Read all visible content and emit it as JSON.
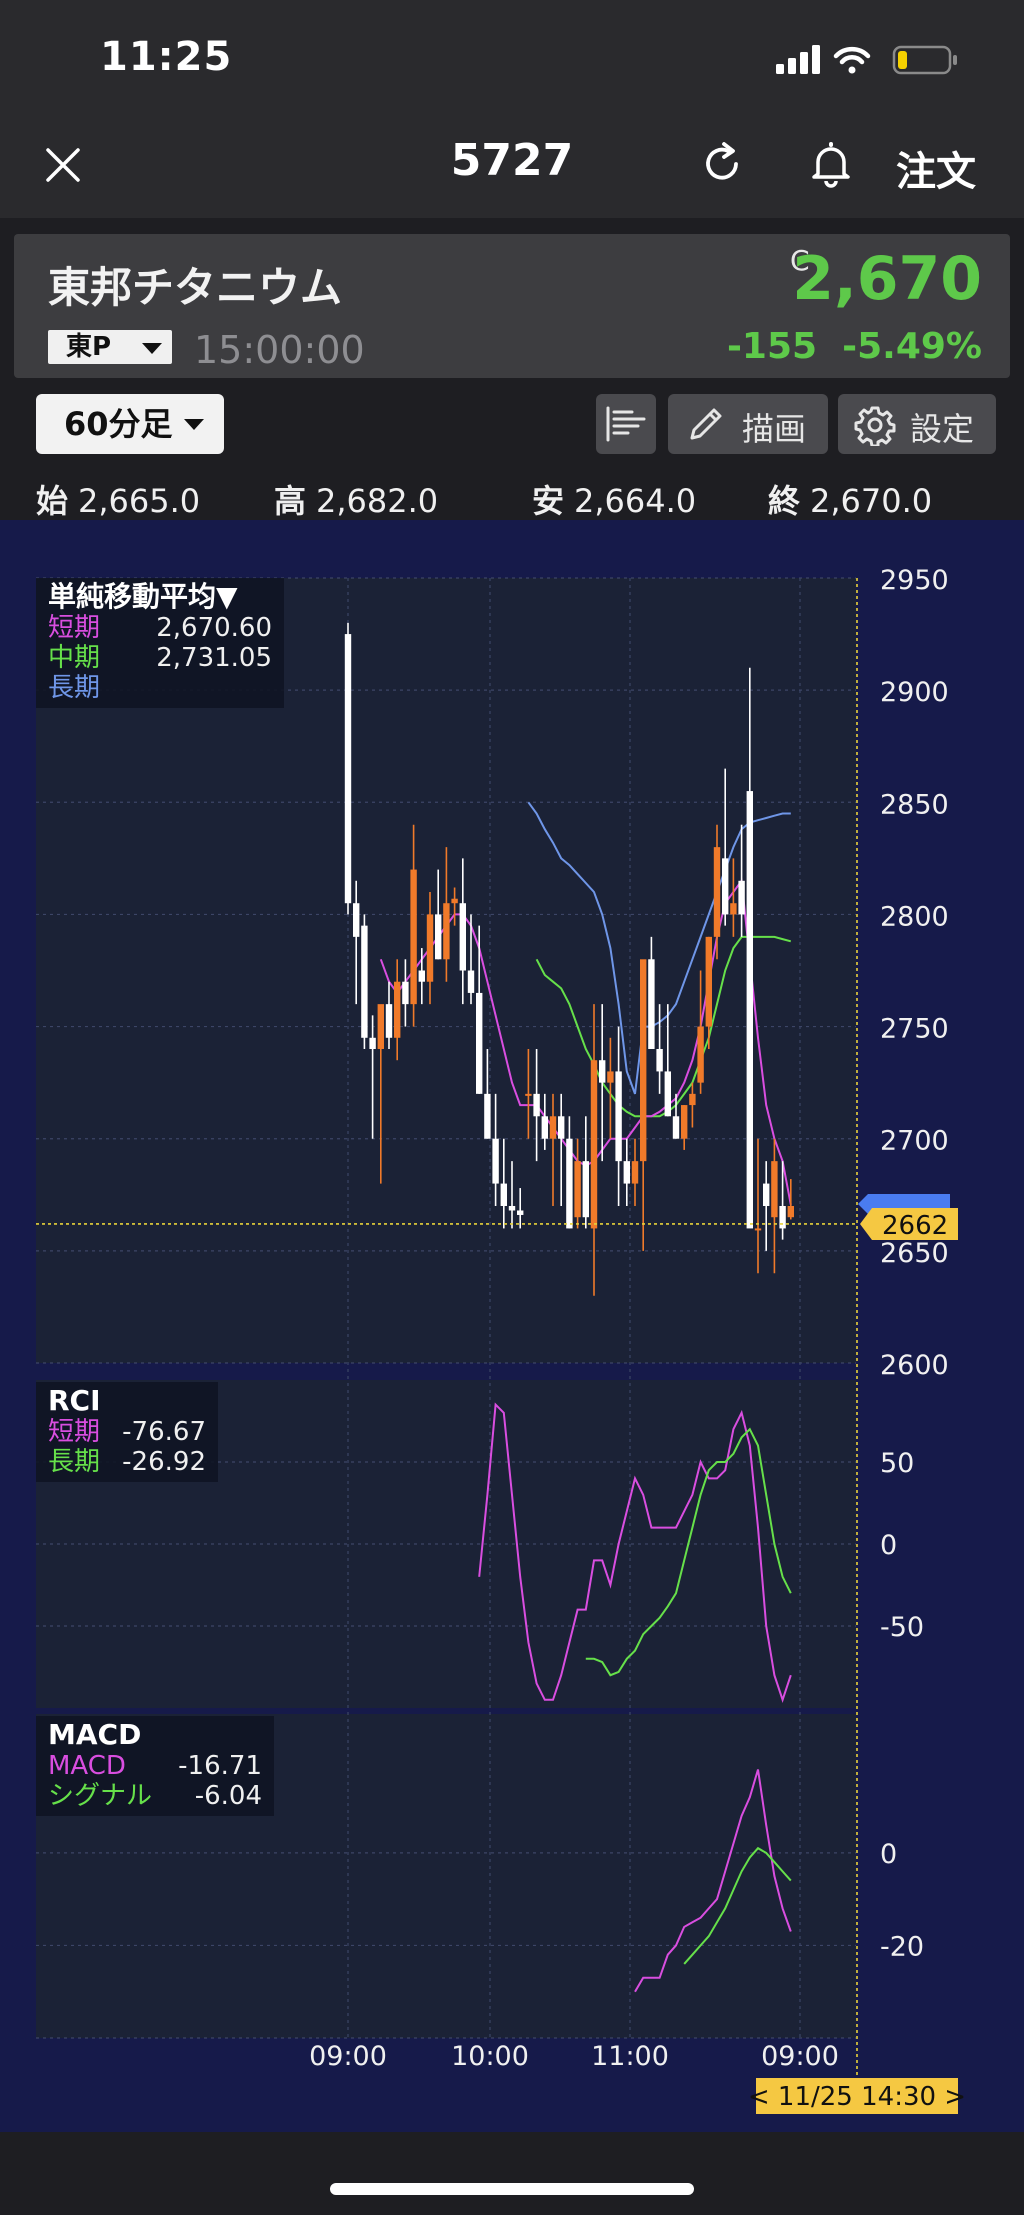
{
  "status_bar": {
    "time": "11:25"
  },
  "nav": {
    "title": "5727",
    "order_label": "注文"
  },
  "quote": {
    "name": "東邦チタニウム",
    "market": "東P",
    "time": "15:00:00",
    "price_flag": "C",
    "price": "2,670",
    "change": "-155",
    "change_pct": "-5.49%",
    "accent_up": "#5ec94a"
  },
  "toolbar": {
    "period": "60分足",
    "draw_label": "描画",
    "settings_label": "設定"
  },
  "ohlc": {
    "open_label": "始",
    "open": "2,665.0",
    "high_label": "高",
    "high": "2,682.0",
    "low_label": "安",
    "low": "2,664.0",
    "close_label": "終",
    "close": "2,670.0"
  },
  "chart_data": {
    "type": "candlestick",
    "x_labels": [
      "09:00",
      "10:00",
      "11:00",
      "09:00"
    ],
    "cursor_label": "< 11/25 14:30 >",
    "price_axis": {
      "ticks": [
        "2950",
        "2900",
        "2850",
        "2800",
        "2750",
        "2700",
        "2650",
        "2600"
      ],
      "ylim": [
        2600,
        2950
      ]
    },
    "current_price_tag": "2662",
    "sma_legend": {
      "title": "単純移動平均▼",
      "rows": [
        {
          "label": "短期",
          "value": "2,670.60",
          "color": "#d94ee0"
        },
        {
          "label": "中期",
          "value": "2,731.05",
          "color": "#66e04a"
        },
        {
          "label": "長期",
          "value": "",
          "color": "#6f96e8"
        }
      ]
    },
    "rci": {
      "title": "RCI",
      "ticks": [
        "50",
        "0",
        "-50"
      ],
      "rows": [
        {
          "label": "短期",
          "value": "-76.67",
          "color": "#d94ee0"
        },
        {
          "label": "長期",
          "value": "-26.92",
          "color": "#66e04a"
        }
      ],
      "short": [
        null,
        null,
        null,
        null,
        null,
        null,
        null,
        null,
        null,
        null,
        null,
        null,
        null,
        null,
        null,
        null,
        -20,
        30,
        85,
        80,
        30,
        -20,
        -60,
        -85,
        -95,
        -95,
        -80,
        -60,
        -40,
        -40,
        -10,
        -10,
        -25,
        0,
        20,
        40,
        30,
        10,
        10,
        10,
        10,
        20,
        30,
        50,
        40,
        40,
        45,
        70,
        80,
        60,
        10,
        -50,
        -80,
        -95,
        -80
      ],
      "long": [
        null,
        null,
        null,
        null,
        null,
        null,
        null,
        null,
        null,
        null,
        null,
        null,
        null,
        null,
        null,
        null,
        null,
        null,
        null,
        null,
        null,
        null,
        null,
        null,
        null,
        null,
        null,
        null,
        null,
        -70,
        -70,
        -72,
        -80,
        -78,
        -70,
        -65,
        -55,
        -50,
        -45,
        -38,
        -30,
        -10,
        10,
        30,
        45,
        50,
        50,
        55,
        65,
        70,
        60,
        30,
        0,
        -20,
        -30
      ]
    },
    "macd": {
      "title": "MACD",
      "ticks": [
        "0",
        "-20"
      ],
      "rows": [
        {
          "label": "MACD",
          "value": "-16.71",
          "color": "#d94ee0"
        },
        {
          "label": "シグナル",
          "value": "-6.04",
          "color": "#66e04a"
        }
      ],
      "macd": [
        null,
        null,
        null,
        null,
        null,
        null,
        null,
        null,
        null,
        null,
        null,
        null,
        null,
        null,
        null,
        null,
        null,
        null,
        null,
        null,
        null,
        null,
        null,
        null,
        null,
        null,
        null,
        null,
        null,
        null,
        null,
        null,
        null,
        null,
        null,
        -30,
        -27,
        -27,
        -27,
        -22,
        -20,
        -16,
        -15,
        -14,
        -12,
        -10,
        -4,
        2,
        8,
        12,
        18,
        6,
        -5,
        -12,
        -17
      ],
      "signal": [
        null,
        null,
        null,
        null,
        null,
        null,
        null,
        null,
        null,
        null,
        null,
        null,
        null,
        null,
        null,
        null,
        null,
        null,
        null,
        null,
        null,
        null,
        null,
        null,
        null,
        null,
        null,
        null,
        null,
        null,
        null,
        null,
        null,
        null,
        null,
        null,
        null,
        null,
        null,
        null,
        null,
        -24,
        -22,
        -20,
        -18,
        -15,
        -12,
        -8,
        -4,
        -1,
        1,
        0,
        -2,
        -4,
        -6
      ]
    },
    "candles": [
      [
        2925,
        2930,
        2800,
        2805
      ],
      [
        2805,
        2815,
        2760,
        2790
      ],
      [
        2795,
        2800,
        2740,
        2745
      ],
      [
        2745,
        2755,
        2700,
        2740
      ],
      [
        2740,
        2745,
        2680,
        2760
      ],
      [
        2760,
        2770,
        2740,
        2745
      ],
      [
        2745,
        2780,
        2735,
        2770
      ],
      [
        2770,
        2780,
        2750,
        2760
      ],
      [
        2760,
        2840,
        2750,
        2820
      ],
      [
        2775,
        2785,
        2760,
        2770
      ],
      [
        2770,
        2810,
        2760,
        2800
      ],
      [
        2800,
        2820,
        2780,
        2780
      ],
      [
        2780,
        2830,
        2770,
        2805
      ],
      [
        2805,
        2812,
        2795,
        2807
      ],
      [
        2805,
        2825,
        2760,
        2775
      ],
      [
        2775,
        2800,
        2760,
        2765
      ],
      [
        2765,
        2795,
        2720,
        2720
      ],
      [
        2720,
        2740,
        2700,
        2700
      ],
      [
        2700,
        2720,
        2670,
        2680
      ],
      [
        2680,
        2700,
        2660,
        2670
      ],
      [
        2670,
        2690,
        2660,
        2668
      ],
      [
        2668,
        2678,
        2660,
        2666
      ],
      [
        2720,
        2740,
        2700,
        2720
      ],
      [
        2720,
        2740,
        2690,
        2710
      ],
      [
        2710,
        2720,
        2695,
        2700
      ],
      [
        2700,
        2720,
        2670,
        2710
      ],
      [
        2710,
        2720,
        2670,
        2700
      ],
      [
        2700,
        2710,
        2660,
        2660
      ],
      [
        2665,
        2700,
        2660,
        2690
      ],
      [
        2690,
        2710,
        2660,
        2665
      ],
      [
        2660,
        2760,
        2630,
        2735
      ],
      [
        2735,
        2760,
        2690,
        2725
      ],
      [
        2725,
        2745,
        2700,
        2730
      ],
      [
        2730,
        2750,
        2670,
        2690
      ],
      [
        2690,
        2700,
        2670,
        2680
      ],
      [
        2680,
        2700,
        2670,
        2690
      ],
      [
        2690,
        2750,
        2650,
        2780
      ],
      [
        2780,
        2790,
        2740,
        2740
      ],
      [
        2740,
        2760,
        2720,
        2730
      ],
      [
        2730,
        2760,
        2710,
        2710
      ],
      [
        2710,
        2720,
        2700,
        2700
      ],
      [
        2700,
        2715,
        2695,
        2715
      ],
      [
        2715,
        2725,
        2705,
        2720
      ],
      [
        2725,
        2775,
        2720,
        2750
      ],
      [
        2750,
        2790,
        2740,
        2790
      ],
      [
        2790,
        2840,
        2780,
        2830
      ],
      [
        2825,
        2865,
        2795,
        2800
      ],
      [
        2800,
        2825,
        2790,
        2805
      ],
      [
        2815,
        2840,
        2790,
        2800
      ],
      [
        2855,
        2910,
        2850,
        2660
      ],
      [
        2660,
        2700,
        2640,
        2660
      ],
      [
        2680,
        2690,
        2650,
        2670
      ],
      [
        2665,
        2700,
        2640,
        2690
      ],
      [
        2670,
        2690,
        2655,
        2660
      ],
      [
        2665,
        2682,
        2664,
        2670
      ]
    ],
    "sma_short": [
      null,
      null,
      null,
      null,
      2780,
      2770,
      2765,
      2770,
      2775,
      2780,
      2785,
      2790,
      2795,
      2800,
      2800,
      2795,
      2785,
      2770,
      2755,
      2740,
      2725,
      2715,
      2715,
      2715,
      2710,
      2705,
      2700,
      2695,
      2690,
      2688,
      2690,
      2695,
      2700,
      2700,
      2700,
      2705,
      2710,
      2710,
      2712,
      2715,
      2718,
      2725,
      2735,
      2750,
      2770,
      2790,
      2805,
      2810,
      2815,
      2780,
      2745,
      2715,
      2700,
      2690,
      2670.6
    ],
    "sma_mid": [
      null,
      null,
      null,
      null,
      null,
      null,
      null,
      null,
      null,
      null,
      null,
      null,
      null,
      null,
      null,
      null,
      null,
      null,
      null,
      null,
      null,
      null,
      null,
      2780,
      2773,
      2770,
      2767,
      2760,
      2750,
      2740,
      2733,
      2725,
      2720,
      2715,
      2712,
      2710,
      2710,
      2710,
      2710,
      2712,
      2715,
      2720,
      2725,
      2735,
      2745,
      2760,
      2775,
      2785,
      2790,
      2790,
      2790,
      2790,
      2790,
      2789,
      2788
    ],
    "sma_long": [
      null,
      null,
      null,
      null,
      null,
      null,
      null,
      null,
      null,
      null,
      null,
      null,
      null,
      null,
      null,
      null,
      null,
      null,
      null,
      null,
      null,
      null,
      2850,
      2845,
      2838,
      2832,
      2825,
      2822,
      2818,
      2814,
      2810,
      2800,
      2785,
      2760,
      2730,
      2720,
      2750,
      2750,
      2752,
      2755,
      2760,
      2770,
      2780,
      2790,
      2800,
      2810,
      2820,
      2830,
      2838,
      2841,
      2842,
      2843,
      2844,
      2845,
      2845
    ]
  }
}
